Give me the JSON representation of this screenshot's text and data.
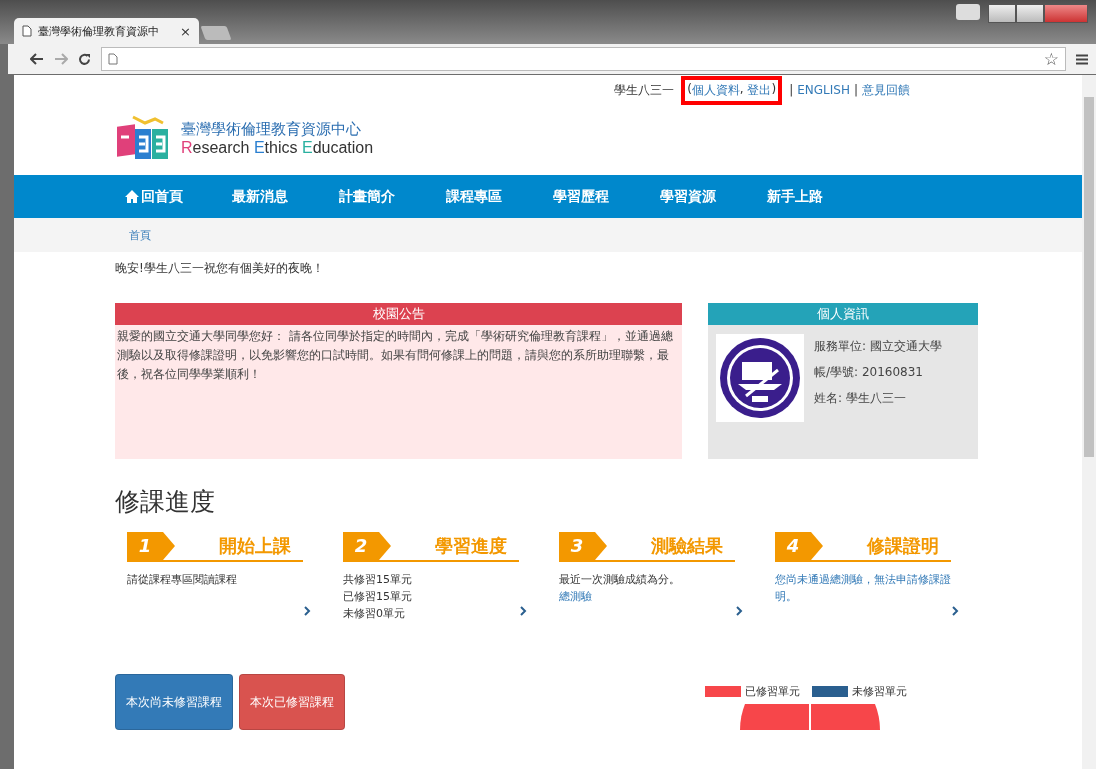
{
  "browser": {
    "tab_title": "臺灣學術倫理教育資源中",
    "tab_close": "×",
    "star": "☆"
  },
  "top_links": {
    "user": "學生八三一",
    "open_paren": "(",
    "profile": "個人資料",
    "comma": ",",
    "logout": "登出",
    "close_paren": ")",
    "sep1": "|",
    "english": "ENGLISH",
    "sep2": "|",
    "feedback": "意見回饋"
  },
  "logo": {
    "title": "臺灣學術倫理教育資源中心",
    "subtitle": [
      {
        "text": "R",
        "color": "#e0407a"
      },
      {
        "text": "esearch ",
        "color": "#333333"
      },
      {
        "text": "E",
        "color": "#2a7fd0"
      },
      {
        "text": "thics ",
        "color": "#333333"
      },
      {
        "text": "E",
        "color": "#2ab0a0"
      },
      {
        "text": "ducation",
        "color": "#333333"
      }
    ]
  },
  "nav": [
    {
      "label": "回首頁",
      "home": true
    },
    {
      "label": "最新消息",
      "home": false
    },
    {
      "label": "計畫簡介",
      "home": false
    },
    {
      "label": "課程專區",
      "home": false
    },
    {
      "label": "學習歷程",
      "home": false
    },
    {
      "label": "學習資源",
      "home": false
    },
    {
      "label": "新手上路",
      "home": false
    }
  ],
  "breadcrumb": "首頁",
  "greeting": "晚安!學生八三一祝您有個美好的夜晚！",
  "announcement": {
    "title": "校園公告",
    "body": "親愛的國立交通大學同學您好： 請各位同學於指定的時間內，完成「學術研究倫理教育課程」，並通過總測驗以及取得修課證明，以免影響您的口試時間。如果有問何修課上的問題，請與您的系所助理聯繫，最後，祝各位同學學業順利！"
  },
  "profile": {
    "title": "個人資訊",
    "fields": [
      "服務單位: 國立交通大學",
      "帳/學號: 20160831",
      "姓名: 學生八三一"
    ]
  },
  "progress": {
    "title": "修課進度",
    "steps": [
      {
        "number": "1",
        "title": "開始上課",
        "lines": [
          {
            "text": "請從課程專區閱讀課程",
            "kind": "plain"
          }
        ]
      },
      {
        "number": "2",
        "title": "學習進度",
        "lines": [
          {
            "text": "共修習15單元",
            "kind": "plain"
          },
          {
            "text": "已修習15單元",
            "kind": "plain"
          },
          {
            "text": "未修習0單元",
            "kind": "plain"
          }
        ]
      },
      {
        "number": "3",
        "title": "測驗結果",
        "lines": [
          {
            "text": "最近一次測驗成績為分。",
            "kind": "plain"
          },
          {
            "text": "總測驗",
            "kind": "link"
          }
        ]
      },
      {
        "number": "4",
        "title": "修課證明",
        "lines": [
          {
            "text": "您尚未通過總測驗，無法申請修課證明。",
            "kind": "link"
          }
        ]
      }
    ]
  },
  "buttons": [
    {
      "label": "本次尚未修習課程",
      "color": "#337ab7"
    },
    {
      "label": "本次已修習課程",
      "color": "#d9534f"
    }
  ],
  "legend": [
    {
      "label": "已修習單元",
      "color": "#f7464a"
    },
    {
      "label": "未修習單元",
      "color": "#2a5f8f"
    }
  ]
}
